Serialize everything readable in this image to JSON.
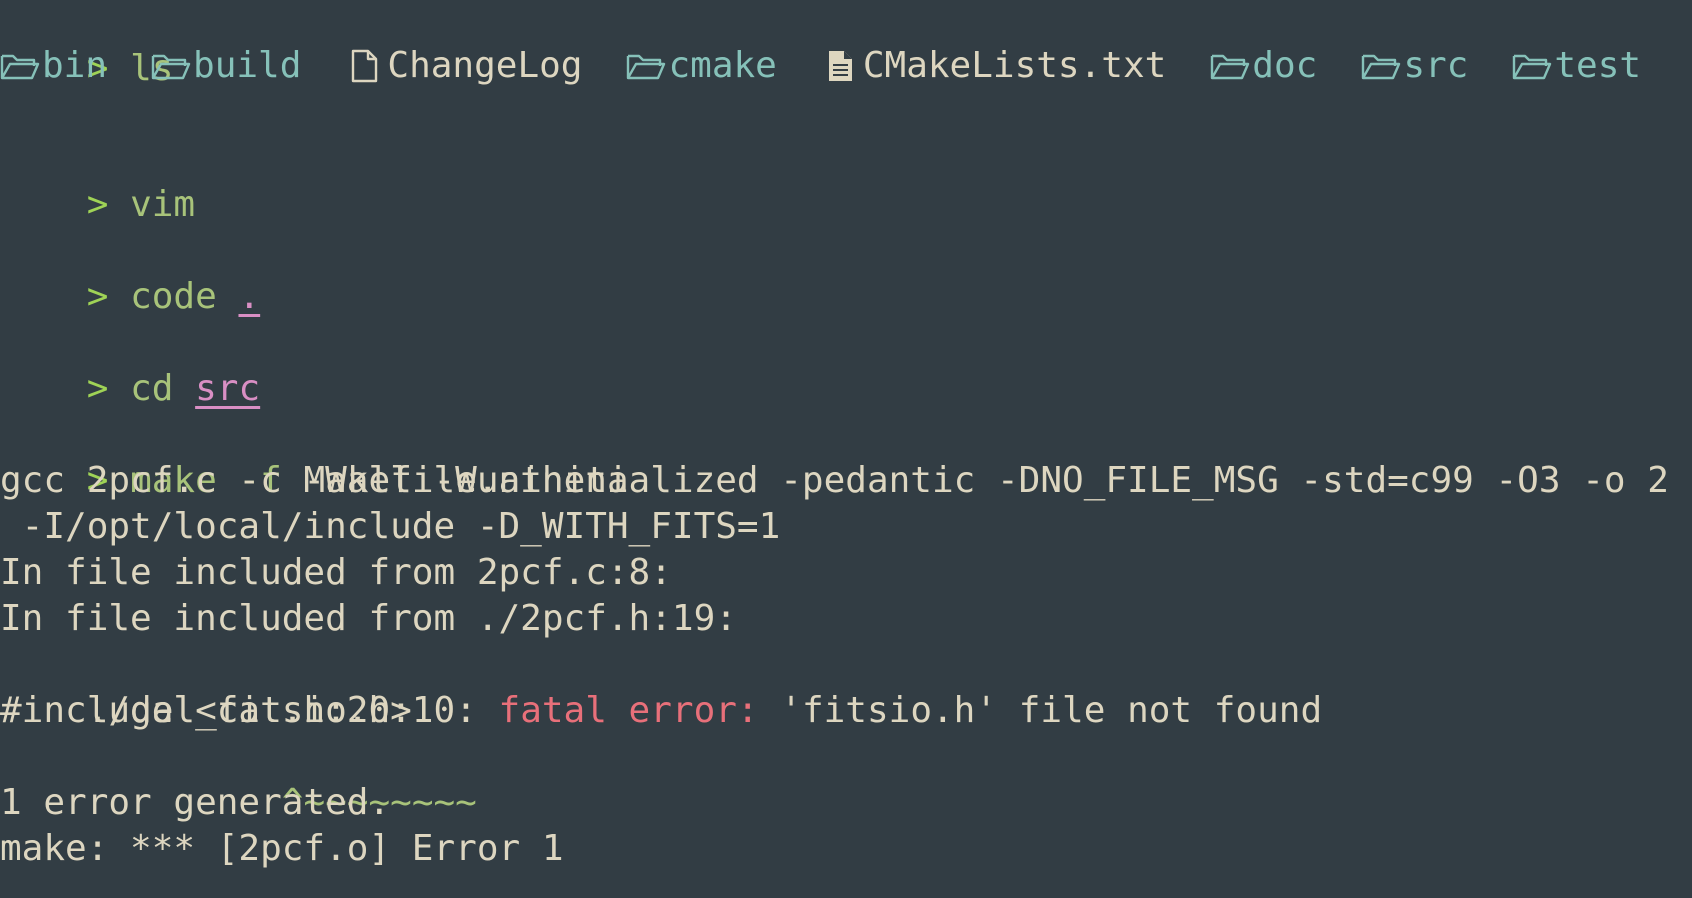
{
  "colors": {
    "background": "#323d44",
    "prompt": "#9fd356",
    "command": "#a8c37a",
    "text": "#ddd6c0",
    "path_underline": "#d98fc4",
    "directory": "#86c1b9",
    "error": "#e8707a"
  },
  "prompt_symbol": ">",
  "commands": [
    {
      "name": "ls",
      "arg": ""
    },
    {
      "name": "vim",
      "arg": ""
    },
    {
      "name": "code",
      "arg": "."
    },
    {
      "name": "cd",
      "arg": "src"
    },
    {
      "name": "make",
      "flag": "-f",
      "arg": "Makefile.athena"
    }
  ],
  "ls_entries": [
    {
      "name": "bin",
      "type": "directory",
      "icon": "folder-icon"
    },
    {
      "name": "build",
      "type": "directory",
      "icon": "folder-icon"
    },
    {
      "name": "ChangeLog",
      "type": "file",
      "icon": "file-icon"
    },
    {
      "name": "cmake",
      "type": "directory",
      "icon": "folder-icon"
    },
    {
      "name": "CMakeLists.txt",
      "type": "file",
      "icon": "text-file-icon"
    },
    {
      "name": "doc",
      "type": "directory",
      "icon": "folder-icon"
    },
    {
      "name": "src",
      "type": "directory",
      "icon": "folder-icon"
    },
    {
      "name": "test",
      "type": "directory",
      "icon": "folder-icon"
    }
  ],
  "output": {
    "gcc_line": "gcc 2pcf.c -c -Wall -Wuninitialized -pedantic -DNO_FILE_MSG -std=c99 -O3 -o 2",
    "gcc_line_cont": " -I/opt/local/include -D_WITH_FITS=1",
    "included_1": "In file included from 2pcf.c:8:",
    "included_2": "In file included from ./2pcf.h:19:",
    "error_location": "./gal_cat.h:20:10: ",
    "error_label": "fatal error:",
    "error_message": " 'fitsio.h' file not found",
    "include_line": "#include <fitsio.h>",
    "caret_indent": "         ",
    "caret_line": "^~~~~~~~~",
    "summary": "1 error generated.",
    "make_error": "make: *** [2pcf.o] Error 1"
  }
}
